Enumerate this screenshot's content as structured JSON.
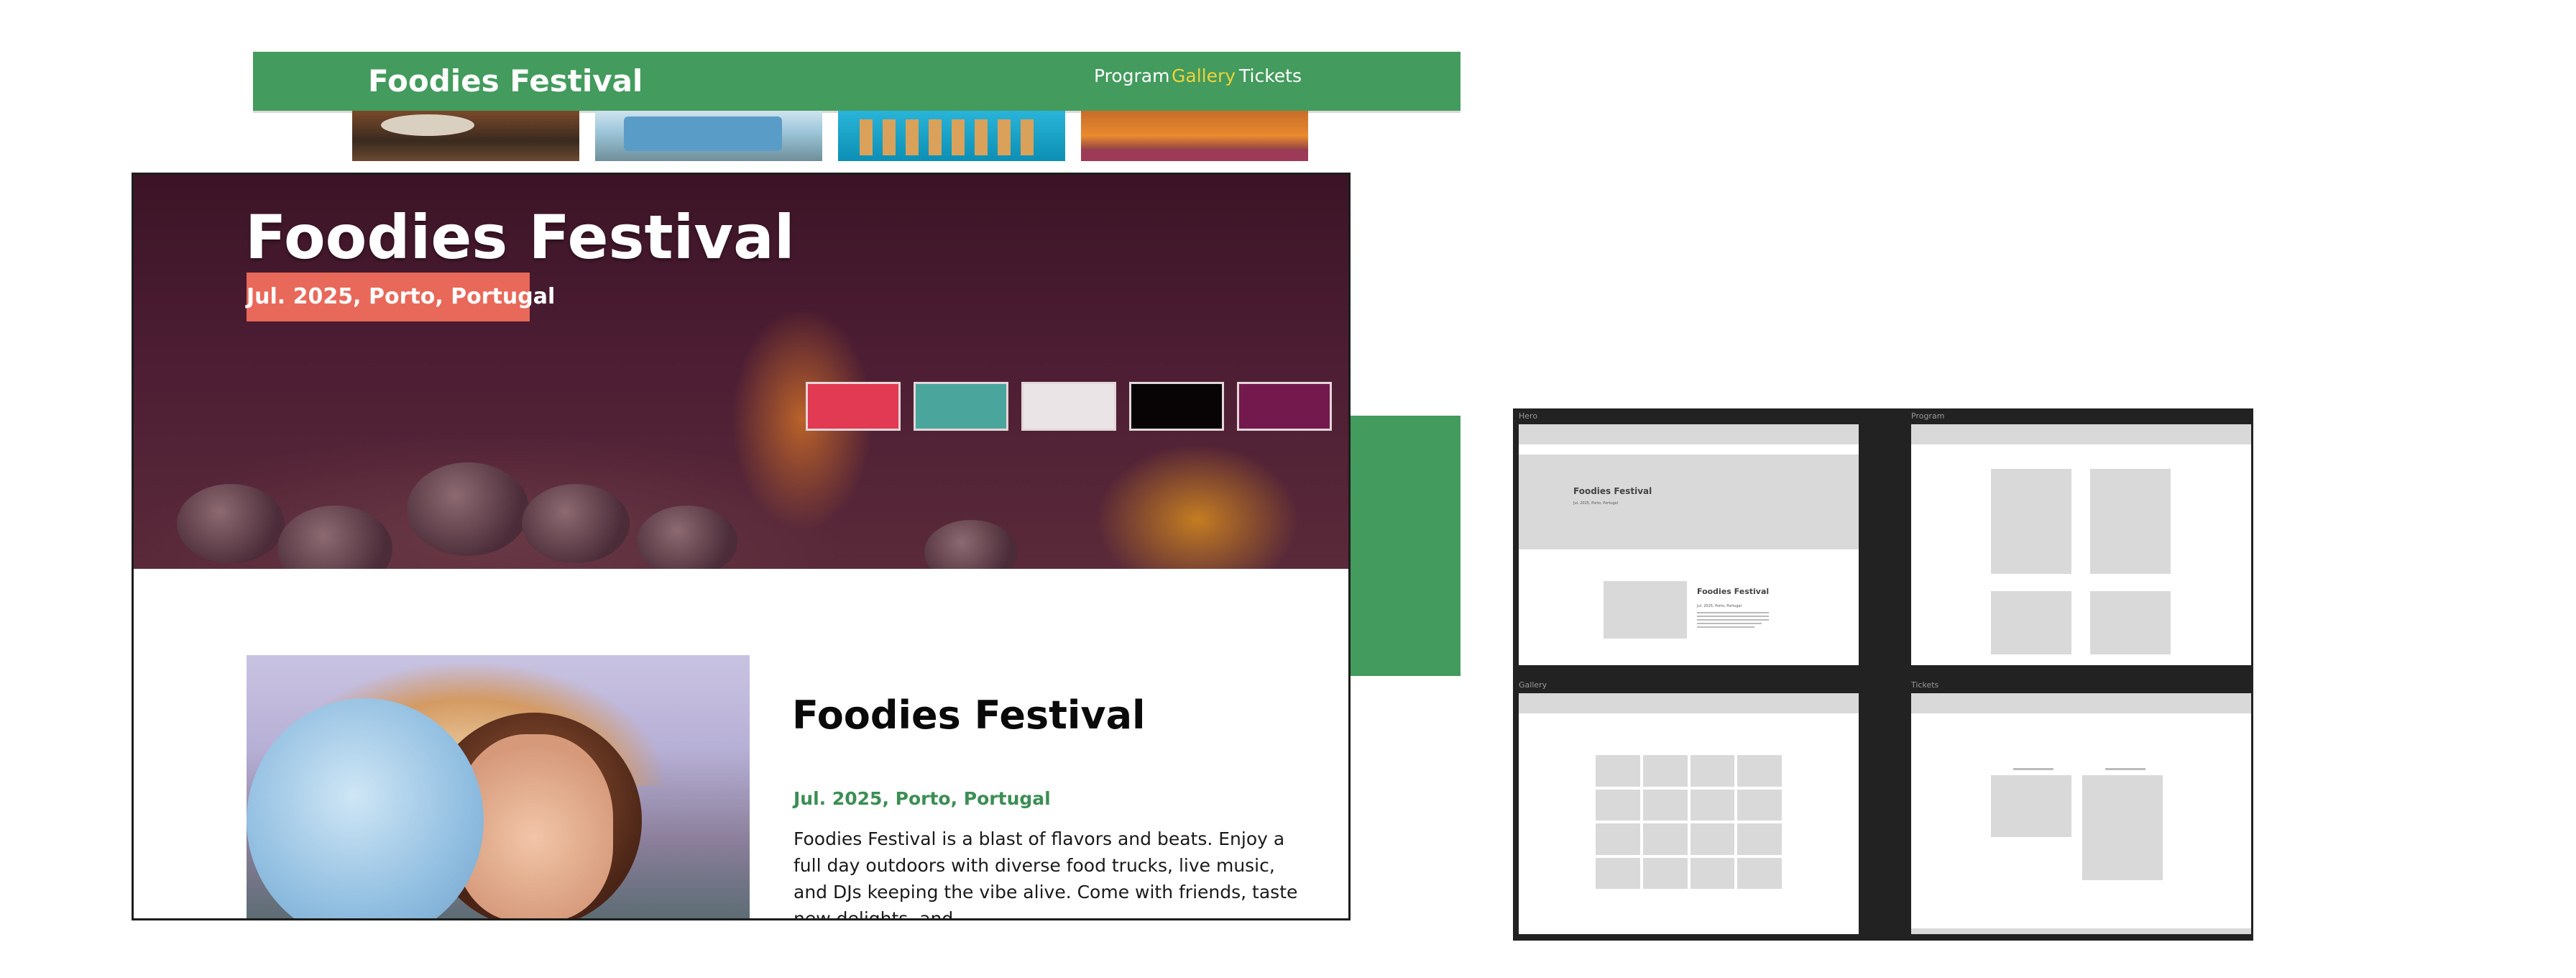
{
  "back_page": {
    "logo": "Foodies Festival",
    "nav": [
      {
        "label": "Program",
        "active": false
      },
      {
        "label": "Gallery",
        "active": true
      },
      {
        "label": "Tickets",
        "active": false
      }
    ],
    "colors": {
      "nav_bg": "#439b5d",
      "nav_active": "#f1d23a"
    }
  },
  "hero": {
    "title": "Foodies Festival",
    "badge": "Jul. 2025, Porto, Portugal",
    "palette": [
      "#e23a52",
      "#4aa59c",
      "#eae4e6",
      "#080405",
      "#73194d"
    ]
  },
  "about": {
    "title": "Foodies Festival",
    "date": "Jul. 2025, Porto, Portugal",
    "text": "Foodies Festival is a blast of flavors and beats. Enjoy a full day outdoors with diverse food trucks, live music, and DJs keeping the vibe alive. Come with friends, taste new delights, and"
  },
  "wireframes": {
    "hero": {
      "label": "Hero",
      "title": "Foodies Festival",
      "date": "Jul. 2025, Porto, Portugal",
      "card_title": "Foodies Festival",
      "card_date": "Jul. 2025, Porto, Portugal"
    },
    "program": {
      "label": "Program"
    },
    "gallery": {
      "label": "Gallery"
    },
    "tickets": {
      "label": "Tickets"
    }
  }
}
